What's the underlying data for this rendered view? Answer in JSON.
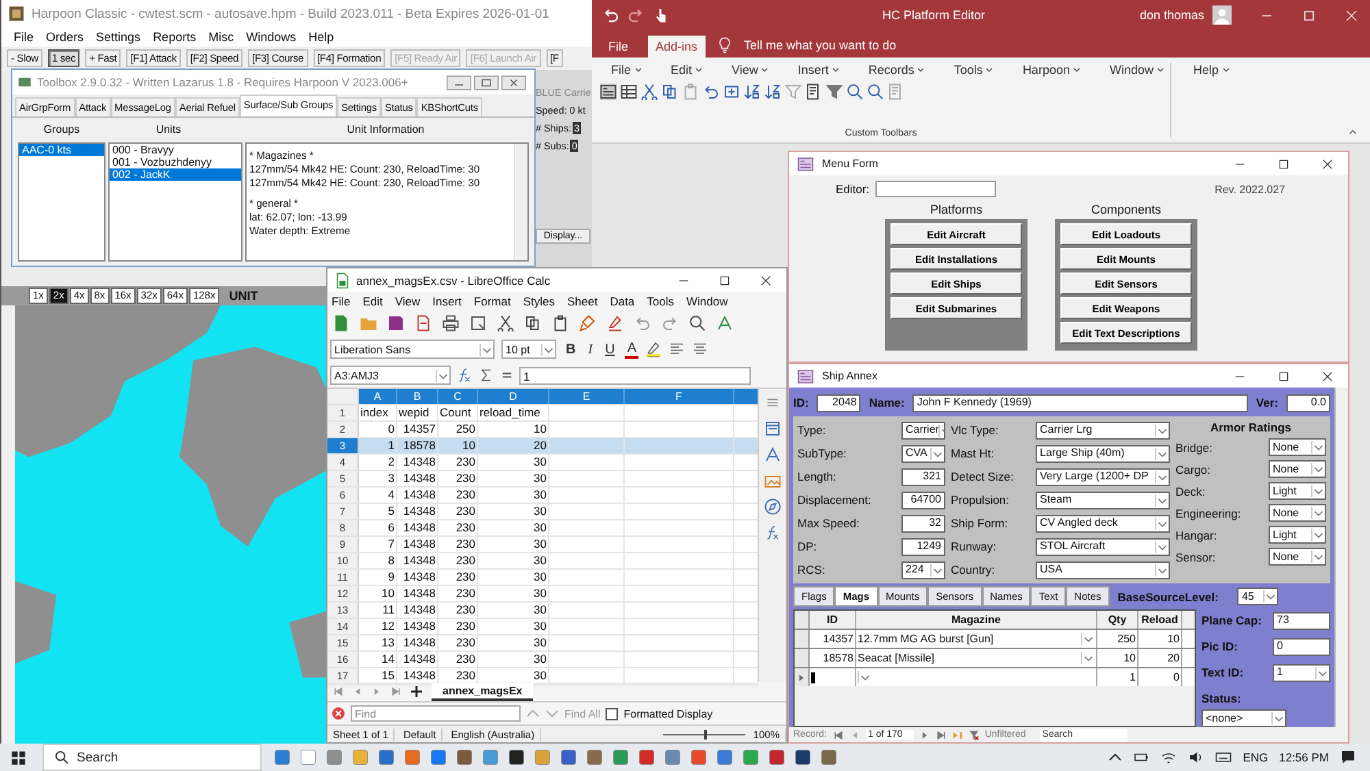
{
  "harpoon": {
    "title": "Harpoon Classic - cwtest.scm - autosave.hpm - Build 2023.011 - Beta Expires 2026-01-01",
    "menu": [
      "File",
      "Orders",
      "Settings",
      "Reports",
      "Misc",
      "Windows",
      "Help"
    ],
    "speed_buttons": [
      {
        "label": "- Slow",
        "selected": false,
        "disabled": false
      },
      {
        "label": "1 sec",
        "selected": true,
        "disabled": false
      },
      {
        "label": "+ Fast",
        "selected": false,
        "disabled": false
      },
      {
        "label": "[F1] Attack",
        "selected": false,
        "disabled": false
      },
      {
        "label": "[F2] Speed",
        "selected": false,
        "disabled": false
      },
      {
        "label": "[F3] Course",
        "selected": false,
        "disabled": false
      },
      {
        "label": "[F4] Formation",
        "selected": false,
        "disabled": false
      },
      {
        "label": "[F5] Ready Air",
        "selected": false,
        "disabled": true
      },
      {
        "label": "[F6] Launch Air",
        "selected": false,
        "disabled": true
      },
      {
        "label": "[F",
        "selected": false,
        "disabled": false
      }
    ],
    "side_panel": {
      "title": "BLUE Carrie",
      "speed": "Speed: 0 kt",
      "ships_label": "# Ships:",
      "ships": "3",
      "subs_label": "# Subs:",
      "subs": "0",
      "display_button": "Display..."
    },
    "zoom_buttons": [
      {
        "label": "1x",
        "selected": false
      },
      {
        "label": "2x",
        "selected": true
      },
      {
        "label": "4x",
        "selected": false
      },
      {
        "label": "8x",
        "selected": false
      },
      {
        "label": "16x",
        "selected": false
      },
      {
        "label": "32x",
        "selected": false
      },
      {
        "label": "64x",
        "selected": false
      },
      {
        "label": "128x",
        "selected": false
      }
    ],
    "zoom_mode": "UNIT"
  },
  "toolbox": {
    "title": "Toolbox 2.9.0.32 - Written Lazarus 1.8 - Requires Harpoon V 2023.006+",
    "tabs": [
      {
        "label": "AirGrpForm",
        "selected": false
      },
      {
        "label": "Attack",
        "selected": false
      },
      {
        "label": "MessageLog",
        "selected": false
      },
      {
        "label": "Aerial Refuel",
        "selected": false
      },
      {
        "label": "Surface/Sub Groups",
        "selected": true
      },
      {
        "label": "Settings",
        "selected": false
      },
      {
        "label": "Status",
        "selected": false
      },
      {
        "label": "KBShortCuts",
        "selected": false
      }
    ],
    "headers": [
      "Groups",
      "Units",
      "Unit Information"
    ],
    "groups": [
      {
        "label": "AAC-0 kts",
        "selected": true
      }
    ],
    "units": [
      {
        "label": "000 - Bravyy",
        "selected": false
      },
      {
        "label": "001 - Vozbuzhdenyy",
        "selected": false
      },
      {
        "label": "002 - JackK",
        "selected": true
      }
    ],
    "info_blocks": [
      [
        "* Magazines *",
        "127mm/54 Mk42 HE: Count: 230, ReloadTime: 30",
        "127mm/54 Mk42 HE: Count: 230, ReloadTime: 30"
      ],
      [
        "* general *",
        "lat: 62.07; lon: -13.99",
        "Water depth: Extreme"
      ]
    ]
  },
  "access": {
    "title": "HC Platform Editor",
    "user": "don thomas",
    "tabs": [
      {
        "label": "File",
        "selected": false
      },
      {
        "label": "Add-ins",
        "selected": true
      }
    ],
    "tell_me": "Tell me what you want to do",
    "ribbon_menus": [
      "File",
      "Edit",
      "View",
      "Insert",
      "Records",
      "Tools",
      "Harpoon",
      "Window",
      "Help"
    ],
    "group_label": "Custom Toolbars"
  },
  "menu_form": {
    "title": "Menu Form",
    "editor_label": "Editor:",
    "revision": "Rev. 2022.027",
    "platforms_title": "Platforms",
    "platform_buttons": [
      "Edit Aircraft",
      "Edit Installations",
      "Edit Ships",
      "Edit Submarines"
    ],
    "components_title": "Components",
    "component_buttons": [
      "Edit Loadouts",
      "Edit Mounts",
      "Edit Sensors",
      "Edit Weapons",
      "Edit Text Descriptions"
    ]
  },
  "ship_annex": {
    "title": "Ship Annex",
    "id_label": "ID:",
    "id": "2048",
    "name_label": "Name:",
    "name": "John F Kennedy (1969)",
    "ver_label": "Ver:",
    "ver": "0.0",
    "left_fields": [
      {
        "label": "Type:",
        "value": "Carrier",
        "kind": "combo"
      },
      {
        "label": "SubType:",
        "value": "CVA",
        "kind": "combo"
      },
      {
        "label": "Length:",
        "value": "321",
        "kind": "number"
      },
      {
        "label": "Displacement:",
        "value": "64700",
        "kind": "number"
      },
      {
        "label": "Max Speed:",
        "value": "32",
        "kind": "number"
      },
      {
        "label": "DP:",
        "value": "1249",
        "kind": "number"
      },
      {
        "label": "RCS:",
        "value": "224",
        "kind": "combo"
      }
    ],
    "middle_fields": [
      {
        "label": "Vlc Type:",
        "value": "Carrier Lrg",
        "kind": "combo"
      },
      {
        "label": "Mast Ht:",
        "value": "Large Ship (40m)",
        "kind": "combo"
      },
      {
        "label": "Detect Size:",
        "value": "Very Large (1200+ DP",
        "kind": "combo"
      },
      {
        "label": "Propulsion:",
        "value": "Steam",
        "kind": "combo"
      },
      {
        "label": "Ship Form:",
        "value": "CV Angled deck",
        "kind": "combo"
      },
      {
        "label": "Runway:",
        "value": "STOL Aircraft",
        "kind": "combo"
      },
      {
        "label": "Country:",
        "value": "USA",
        "kind": "combo"
      }
    ],
    "armor_title": "Armor Ratings",
    "armor_fields": [
      {
        "label": "Bridge:",
        "value": "None",
        "kind": "combo"
      },
      {
        "label": "Cargo:",
        "value": "None",
        "kind": "combo"
      },
      {
        "label": "Deck:",
        "value": "Light",
        "kind": "combo"
      },
      {
        "label": "Engineering:",
        "value": "None",
        "kind": "combo"
      },
      {
        "label": "Hangar:",
        "value": "Light",
        "kind": "combo"
      },
      {
        "label": "Sensor:",
        "value": "None",
        "kind": "combo"
      }
    ],
    "tabs": [
      {
        "label": "Flags",
        "selected": false
      },
      {
        "label": "Mags",
        "selected": true
      },
      {
        "label": "Mounts",
        "selected": false
      },
      {
        "label": "Sensors",
        "selected": false
      },
      {
        "label": "Names",
        "selected": false
      },
      {
        "label": "Text",
        "selected": false
      },
      {
        "label": "Notes",
        "selected": false
      }
    ],
    "base_source_label": "BaseSourceLevel:",
    "base_source": "45",
    "grid_columns": [
      "ID",
      "Magazine",
      "Qty",
      "Reload"
    ],
    "grid_rows": [
      {
        "kind": "record",
        "id": "14357",
        "magazine": "12.7mm MG AG burst [Gun]",
        "qty": "250",
        "reload": "10"
      },
      {
        "kind": "record",
        "id": "18578",
        "magazine": "Seacat [Missile]",
        "qty": "10",
        "reload": "20"
      },
      {
        "kind": "new",
        "qty": "1",
        "reload": "0"
      }
    ],
    "side_fields": [
      {
        "label": "Plane Cap:",
        "value": "73",
        "kind": "text"
      },
      {
        "label": "Pic ID:",
        "value": "0",
        "kind": "text"
      },
      {
        "label": "Text ID:",
        "value": "1",
        "kind": "combo"
      }
    ],
    "status_label": "Status:",
    "status": "<none>",
    "record_label": "Record:",
    "record_position": "1 of 170",
    "filter": "Unfiltered",
    "search_placeholder": "Search"
  },
  "calc": {
    "title": "annex_magsEx.csv - LibreOffice Calc",
    "menu": [
      "File",
      "Edit",
      "View",
      "Insert",
      "Format",
      "Styles",
      "Sheet",
      "Data",
      "Tools",
      "Window"
    ],
    "font": "Liberation Sans",
    "font_size": "10 pt",
    "format_buttons": [
      "B",
      "I",
      "U"
    ],
    "font_color_button": "A",
    "name_box": "A3:AMJ3",
    "formula": "1",
    "columns": [
      "A",
      "B",
      "C",
      "D",
      "E",
      "F"
    ],
    "rows": [
      {
        "num": "1",
        "kind": "header",
        "selected": false,
        "cells": [
          "index",
          "wepid",
          "Count",
          "reload_time"
        ]
      },
      {
        "num": "2",
        "kind": "data",
        "selected": false,
        "cells": [
          "0",
          "14357",
          "250",
          "10"
        ]
      },
      {
        "num": "3",
        "kind": "data",
        "selected": true,
        "cells": [
          "1",
          "18578",
          "10",
          "20"
        ]
      },
      {
        "num": "4",
        "kind": "data",
        "selected": false,
        "cells": [
          "2",
          "14348",
          "230",
          "30"
        ]
      },
      {
        "num": "5",
        "kind": "data",
        "selected": false,
        "cells": [
          "3",
          "14348",
          "230",
          "30"
        ]
      },
      {
        "num": "6",
        "kind": "data",
        "selected": false,
        "cells": [
          "4",
          "14348",
          "230",
          "30"
        ]
      },
      {
        "num": "7",
        "kind": "data",
        "selected": false,
        "cells": [
          "5",
          "14348",
          "230",
          "30"
        ]
      },
      {
        "num": "8",
        "kind": "data",
        "selected": false,
        "cells": [
          "6",
          "14348",
          "230",
          "30"
        ]
      },
      {
        "num": "9",
        "kind": "data",
        "selected": false,
        "cells": [
          "7",
          "14348",
          "230",
          "30"
        ]
      },
      {
        "num": "10",
        "kind": "data",
        "selected": false,
        "cells": [
          "8",
          "14348",
          "230",
          "30"
        ]
      },
      {
        "num": "11",
        "kind": "data",
        "selected": false,
        "cells": [
          "9",
          "14348",
          "230",
          "30"
        ]
      },
      {
        "num": "12",
        "kind": "data",
        "selected": false,
        "cells": [
          "10",
          "14348",
          "230",
          "30"
        ]
      },
      {
        "num": "13",
        "kind": "data",
        "selected": false,
        "cells": [
          "11",
          "14348",
          "230",
          "30"
        ]
      },
      {
        "num": "14",
        "kind": "data",
        "selected": false,
        "cells": [
          "12",
          "14348",
          "230",
          "30"
        ]
      },
      {
        "num": "15",
        "kind": "data",
        "selected": false,
        "cells": [
          "13",
          "14348",
          "230",
          "30"
        ]
      },
      {
        "num": "16",
        "kind": "data",
        "selected": false,
        "cells": [
          "14",
          "14348",
          "230",
          "30"
        ]
      },
      {
        "num": "17",
        "kind": "data",
        "selected": false,
        "cells": [
          "15",
          "14348",
          "230",
          "30"
        ]
      }
    ],
    "sheet_tabs": [
      {
        "label": "annex_magsEx",
        "selected": true
      }
    ],
    "find_placeholder": "Find",
    "find_all": "Find All",
    "formatted_display": {
      "label": "Formatted Display",
      "checked": false
    },
    "status": [
      "Sheet 1 of 1",
      "Default",
      "English (Australia)"
    ],
    "zoom_slider": {
      "level": 0.5
    },
    "zoom": "100%"
  },
  "taskbar": {
    "search_placeholder": "Search",
    "language": "ENG",
    "time": "12:56 PM"
  }
}
